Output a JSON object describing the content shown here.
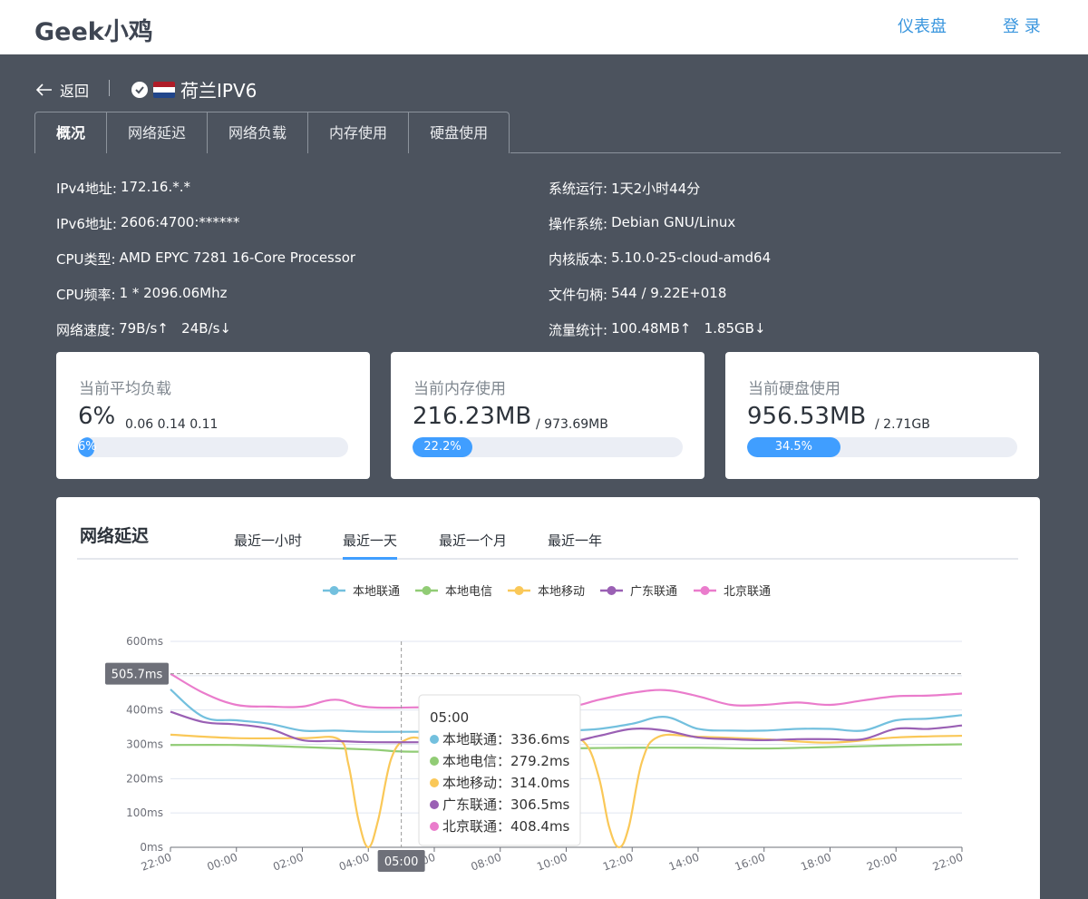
{
  "header": {
    "brand": "Geek小鸡",
    "nav": [
      "仪表盘",
      "登 录"
    ]
  },
  "server": {
    "back_label": "返回",
    "name": "荷兰IPV6"
  },
  "tabs": [
    "概况",
    "网络延迟",
    "网络负载",
    "内存使用",
    "硬盘使用"
  ],
  "info_left": [
    {
      "k": "IPv4地址:",
      "v": "172.16.*.*"
    },
    {
      "k": "IPv6地址:",
      "v": "2606:4700:******"
    },
    {
      "k": "CPU类型:",
      "v": "AMD EPYC 7281 16-Core Processor"
    },
    {
      "k": "CPU频率:",
      "v": "1 * 2096.06Mhz"
    },
    {
      "k": "网络速度:",
      "v": "79B/s↑   24B/s↓"
    }
  ],
  "info_right": [
    {
      "k": "系统运行:",
      "v": "1天2小时44分"
    },
    {
      "k": "操作系统:",
      "v": "Debian GNU/Linux"
    },
    {
      "k": "内核版本:",
      "v": "5.10.0-25-cloud-amd64"
    },
    {
      "k": "文件句柄:",
      "v": "544 / 9.22E+018"
    },
    {
      "k": "流量统计:",
      "v": "100.48MB↑   1.85GB↓"
    }
  ],
  "cards": [
    {
      "title": "当前平均负载",
      "big": "6%",
      "sub": "0.06 0.14 0.11",
      "percent": 6,
      "bar_label": "6%"
    },
    {
      "title": "当前内存使用",
      "big": "216.23MB",
      "sub": "/ 973.69MB",
      "percent": 22.2,
      "bar_label": "22.2%"
    },
    {
      "title": "当前硬盘使用",
      "big": "956.53MB",
      "sub": "/ 2.71GB",
      "percent": 34.5,
      "bar_label": "34.5%"
    }
  ],
  "latency": {
    "title": "网络延迟",
    "ranges": [
      "最近一小时",
      "最近一天",
      "最近一个月",
      "最近一年"
    ],
    "active_range": 1
  },
  "chart_data": {
    "type": "line",
    "x": [
      "22:00",
      "00:00",
      "02:00",
      "04:00",
      "06:00",
      "08:00",
      "10:00",
      "12:00",
      "14:00",
      "16:00",
      "18:00",
      "20:00",
      "22:00"
    ],
    "y_ticks": [
      "0ms",
      "100ms",
      "200ms",
      "300ms",
      "400ms",
      "500ms",
      "600ms"
    ],
    "ylim": [
      0,
      600
    ],
    "legend": [
      "本地联通",
      "本地电信",
      "本地移动",
      "广东联通",
      "北京联通"
    ],
    "series": [
      {
        "name": "本地联通",
        "color": "#73c0de",
        "points": [
          [
            0,
            460
          ],
          [
            0.5,
            380
          ],
          [
            1,
            370
          ],
          [
            1.5,
            360
          ],
          [
            2,
            340
          ],
          [
            2.5,
            340
          ],
          [
            3,
            336.6
          ],
          [
            4,
            336.6
          ],
          [
            5,
            336
          ],
          [
            6,
            340
          ],
          [
            6.5,
            345
          ],
          [
            7,
            360
          ],
          [
            7.5,
            380
          ],
          [
            8,
            345
          ],
          [
            8.5,
            340
          ],
          [
            9,
            340
          ],
          [
            9.5,
            345
          ],
          [
            10,
            345
          ],
          [
            10.5,
            340
          ],
          [
            11,
            370
          ],
          [
            11.5,
            375
          ],
          [
            12,
            385
          ]
        ]
      },
      {
        "name": "本地电信",
        "color": "#91cc75",
        "points": [
          [
            0,
            298
          ],
          [
            1,
            298
          ],
          [
            2,
            292
          ],
          [
            3,
            285
          ],
          [
            3.5,
            279.2
          ],
          [
            4,
            279.2
          ],
          [
            5,
            285
          ],
          [
            6,
            288
          ],
          [
            7,
            290
          ],
          [
            8,
            290
          ],
          [
            9,
            288
          ],
          [
            10,
            292
          ],
          [
            11,
            297
          ],
          [
            12,
            300
          ]
        ]
      },
      {
        "name": "本地移动",
        "color": "#fac858",
        "points": [
          [
            0,
            328
          ],
          [
            1,
            318
          ],
          [
            2,
            318
          ],
          [
            2.55,
            315
          ],
          [
            2.7,
            240
          ],
          [
            2.85,
            80
          ],
          [
            3.0,
            0
          ],
          [
            3.15,
            80
          ],
          [
            3.35,
            260
          ],
          [
            3.6,
            316
          ],
          [
            4,
            314
          ],
          [
            5,
            314
          ],
          [
            6,
            314
          ],
          [
            6.3,
            300
          ],
          [
            6.5,
            200
          ],
          [
            6.65,
            60
          ],
          [
            6.8,
            0
          ],
          [
            6.95,
            60
          ],
          [
            7.15,
            250
          ],
          [
            7.4,
            322
          ],
          [
            8,
            322
          ],
          [
            9,
            315
          ],
          [
            10,
            305
          ],
          [
            11,
            320
          ],
          [
            12,
            325
          ]
        ]
      },
      {
        "name": "广东联通",
        "color": "#9a60b4",
        "points": [
          [
            0,
            395
          ],
          [
            0.5,
            365
          ],
          [
            1,
            358
          ],
          [
            1.5,
            345
          ],
          [
            2,
            312
          ],
          [
            2.5,
            310
          ],
          [
            3,
            306.5
          ],
          [
            4,
            306.5
          ],
          [
            5,
            310
          ],
          [
            6,
            308
          ],
          [
            6.5,
            325
          ],
          [
            7,
            345
          ],
          [
            7.5,
            340
          ],
          [
            8,
            320
          ],
          [
            8.5,
            315
          ],
          [
            9,
            312
          ],
          [
            9.5,
            315
          ],
          [
            10,
            315
          ],
          [
            10.5,
            315
          ],
          [
            11,
            345
          ],
          [
            11.5,
            345
          ],
          [
            12,
            355
          ]
        ]
      },
      {
        "name": "北京联通",
        "color": "#ea7ccc",
        "points": [
          [
            0,
            505.7
          ],
          [
            0.5,
            450
          ],
          [
            1,
            415
          ],
          [
            1.5,
            410
          ],
          [
            2,
            410
          ],
          [
            2.5,
            430
          ],
          [
            3,
            408.4
          ],
          [
            4,
            408.4
          ],
          [
            5,
            410
          ],
          [
            6,
            410
          ],
          [
            6.5,
            430
          ],
          [
            7,
            450
          ],
          [
            7.5,
            458
          ],
          [
            8,
            440
          ],
          [
            8.5,
            415
          ],
          [
            9,
            415
          ],
          [
            9.5,
            422
          ],
          [
            10,
            415
          ],
          [
            10.5,
            428
          ],
          [
            11,
            440
          ],
          [
            11.5,
            442
          ],
          [
            12,
            448
          ]
        ]
      }
    ],
    "crosshair": {
      "x_label": "05:00",
      "y_label": "505.7ms"
    },
    "tooltip": {
      "title": "05:00",
      "rows": [
        {
          "name": "本地联通",
          "value": "336.6ms",
          "color": "#73c0de"
        },
        {
          "name": "本地电信",
          "value": "279.2ms",
          "color": "#91cc75"
        },
        {
          "name": "本地移动",
          "value": "314.0ms",
          "color": "#fac858"
        },
        {
          "name": "广东联通",
          "value": "306.5ms",
          "color": "#9a60b4"
        },
        {
          "name": "北京联通",
          "value": "408.4ms",
          "color": "#ea7ccc"
        }
      ]
    }
  },
  "colors": {
    "accent": "#409eff",
    "link": "#3a96de",
    "page_bg": "#4c535e"
  }
}
